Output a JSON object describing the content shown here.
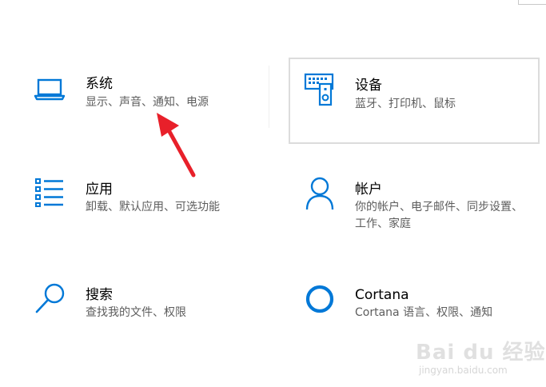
{
  "settings": {
    "tiles": [
      {
        "title": "系统",
        "desc": "显示、声音、通知、电源",
        "icon": "laptop-icon"
      },
      {
        "title": "设备",
        "desc": "蓝牙、打印机、鼠标",
        "icon": "devices-icon"
      },
      {
        "title": "应用",
        "desc": "卸载、默认应用、可选功能",
        "icon": "apps-list-icon"
      },
      {
        "title": "帐户",
        "desc": "你的帐户、电子邮件、同步设置、工作、家庭",
        "icon": "person-icon"
      },
      {
        "title": "搜索",
        "desc": "查找我的文件、权限",
        "icon": "search-icon"
      },
      {
        "title": "Cortana",
        "desc": "Cortana 语言、权限、通知",
        "icon": "cortana-icon"
      }
    ]
  },
  "colors": {
    "accent": "#0078d7",
    "arrow": "#e8202a",
    "desc_text": "#5d5d5d",
    "hover_border": "#dcdcdc"
  },
  "watermark": {
    "main": "Bai du 经验",
    "sub": "jingyan.baidu.com"
  }
}
